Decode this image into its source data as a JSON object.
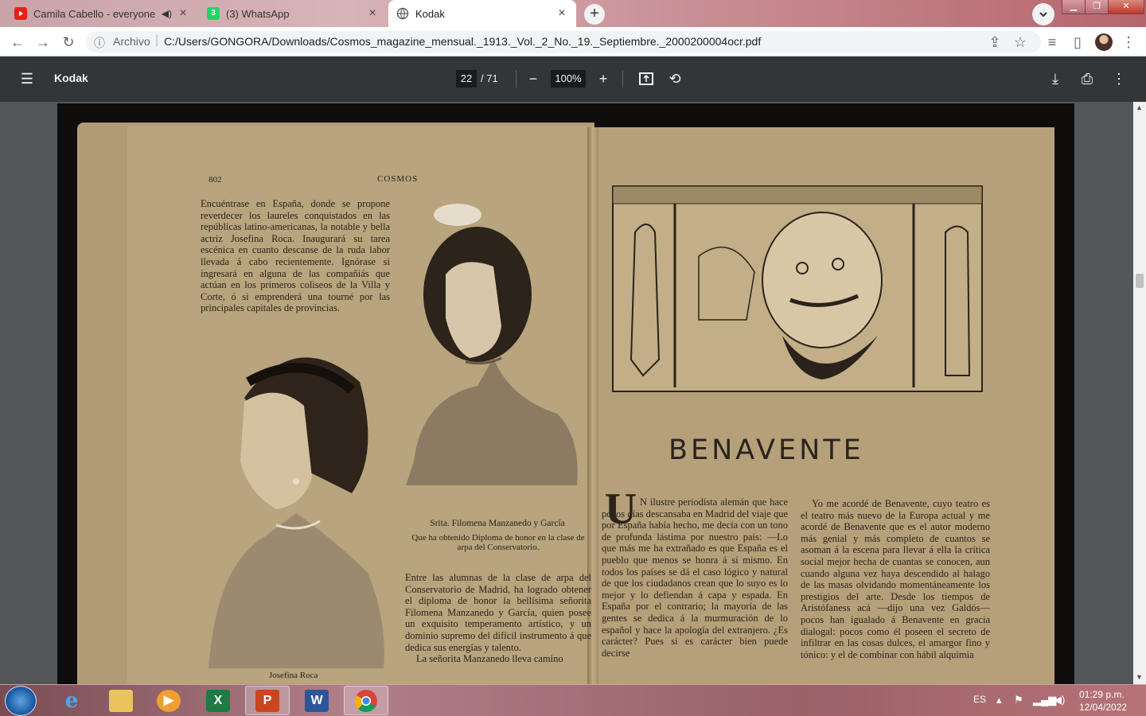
{
  "browser": {
    "tabs": [
      {
        "title": "Camila Cabello - everyone at",
        "favicon": "youtube-icon",
        "audio": true
      },
      {
        "title": "(3) WhatsApp",
        "favicon": "whatsapp-icon",
        "badge": "3"
      },
      {
        "title": "Kodak",
        "favicon": "globe-icon",
        "active": true
      }
    ],
    "new_tab": "+",
    "address": {
      "scheme_label": "Archivo",
      "url": "C:/Users/GONGORA/Downloads/Cosmos_magazine_mensual._1913._Vol._2_No._19._Septiembre._2000200004ocr.pdf"
    }
  },
  "pdf_toolbar": {
    "title": "Kodak",
    "page_current": "22",
    "page_total": "/ 71",
    "zoom": "100%"
  },
  "document": {
    "left_page": {
      "page_number": "802",
      "header": "COSMOS",
      "paragraph1": "Encuéntrase en España, donde se propone reverdecer los laureles conquistados en las repúblicas latino-americanas, la notable y bella actriz Josefina Roca. Inaugurará su tarea escénica en cuanto descanse de la ruda labor llevada á cabo recientemente. Ignórase si ingresará en alguna de las compañiás que actúan en los primeros coliseos de la Villa y Corte, ó si emprenderá una tourné por las principales capitales de provincias.",
      "caption1_title": "Srita. Filomena Manzanedo y García",
      "caption1_sub": "Que ha obtenido Diploma de honor en la clase de arpa del Conservatorio.",
      "paragraph2": "Entre las alumnas de la clase de arpa del Conservatorio de Madrid, ha logrado obtener el diploma de honor la bellísima señorita Filomena Manzanedo y García, quien posee un exquisito temperamento artístico, y un dominio supremo del difícil instrumento á que dedica sus energías y talento.",
      "paragraph3": "La señorita Manzanedo lleva camino",
      "caption2": "Josefina Roca"
    },
    "right_page": {
      "title": "BENAVENTE",
      "dropcap": "U",
      "col1": "N ilustre periodista alemán que hace pocos días descansaba en Madrid del viaje que por España había hecho, me decía con un tono de profunda lástima por nuestro país: —Lo que más me ha extrañado es que España es el pueblo que menos se honra á sí mismo. En todos los países se dá el caso lógico y natural de que los ciudadanos crean que lo suyo es lo mejor y lo defiendan á capa y espada. En España por el contrario; la mayoría de las gentes se dedica á la murmuración de lo español y hace la apología del extranjero. ¿Es carácter? Pues si es carácter bien puede decirse",
      "col2": "Yo me acordé de Benavente, cuyo teatro es el teatro más nuevo de la Europa actual y me acordé de Benavente que es el autor moderno más genial y más completo de cuantos se asoman á la escena para llevar á ella la crítica social mejor hecha de cuantas se conocen, aun cuando alguna vez haya descendido al halago de las masas olvidando momentáneamente los prestigios del arte. Desde los tiempos de Aristófaness acá —dijo una vez Galdós—pocos han igualado á Benavente en gracia dialogal: pocos como él poseen el secreto de infiltrar en las cosas dulces, el amargor fino y tónico: y el de combinar con hábil alquimia"
    }
  },
  "taskbar": {
    "apps": [
      "ie-icon",
      "explorer-icon",
      "media-player-icon",
      "excel-icon",
      "powerpoint-icon",
      "word-icon",
      "chrome-icon"
    ],
    "language": "ES",
    "time": "01:29 p.m.",
    "date": "12/04/2022"
  },
  "colors": {
    "pdf_toolbar": "#323639",
    "viewer_bg": "#525659",
    "paper": "#b5a07a"
  }
}
